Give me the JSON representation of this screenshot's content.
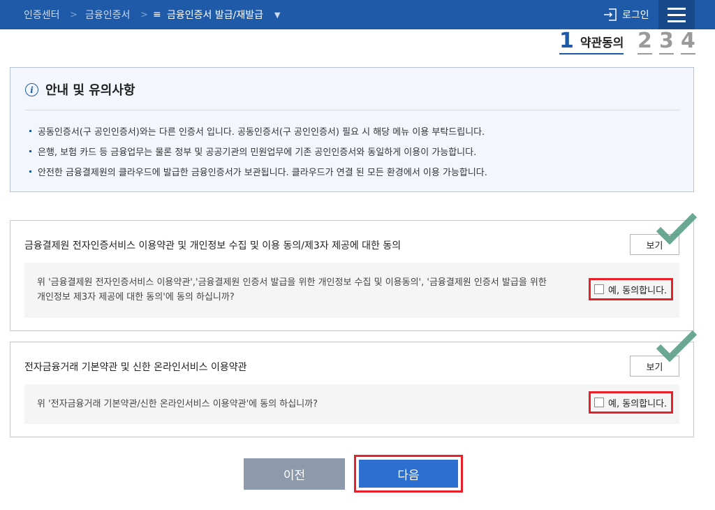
{
  "header": {
    "breadcrumb": [
      "인증센터",
      "금융인증서",
      "금융인증서 발급/재발급"
    ],
    "separator": ">",
    "current_menu_icon": "list-menu-icon",
    "dropdown_icon": "caret-down-icon",
    "login_label": "로그인",
    "login_icon": "login-icon",
    "menu_icon": "hamburger-menu-icon",
    "bar_color": "#1e5aa8"
  },
  "steps": {
    "current_number": "1",
    "current_label": "약관동의",
    "others": [
      "2",
      "3",
      "4"
    ]
  },
  "notice": {
    "icon": "info-icon",
    "title": "안내 및 유의사항",
    "items": [
      "공동인증서(구 공인인증서)와는 다른 인증서 입니다. 공동인증서(구 공인인증서) 필요 시 해당 메뉴 이용 부탁드립니다.",
      "은행, 보험 카드 등 금융업무는 물론 정부 및 공공기관의 민원업무에 기존 공인인증서와 동일하게 이용이 가능합니다.",
      "안전한 금융결제원의 클라우드에 발급한 금융인증서가 보관됩니다. 클라우드가 연결 된 모든 환경에서 이용 가능합니다."
    ]
  },
  "agreements": [
    {
      "title": "금융결제원 전자인증서비스 이용약관 및 개인정보 수집 및 이용 동의/제3자 제공에 대한 동의",
      "view_label": "보기",
      "question": "위 '금융결제원 전자인증서비스 이용약관','금융결제원 인증서 발급을 위한 개인정보 수집 및 이용동의', '금융결제원 인증서 발급을 위한 개인정보 제3자 제공에 대한 동의'에 동의 하십니까?",
      "consent_label": "예, 동의합니다.",
      "checked": false
    },
    {
      "title": "전자금융거래 기본약관 및 신한 온라인서비스 이용약관",
      "view_label": "보기",
      "question": "위 '전자금융거래 기본약관/신한 온라인서비스 이용약관'에 동의 하십니까?",
      "consent_label": "예, 동의합니다.",
      "checked": false
    }
  ],
  "buttons": {
    "prev_label": "이전",
    "next_label": "다음"
  },
  "colors": {
    "primary": "#2c6fd0",
    "highlight": "#e8202a",
    "check_mark": "#5a9e87",
    "prev_button": "#8d9aab"
  }
}
